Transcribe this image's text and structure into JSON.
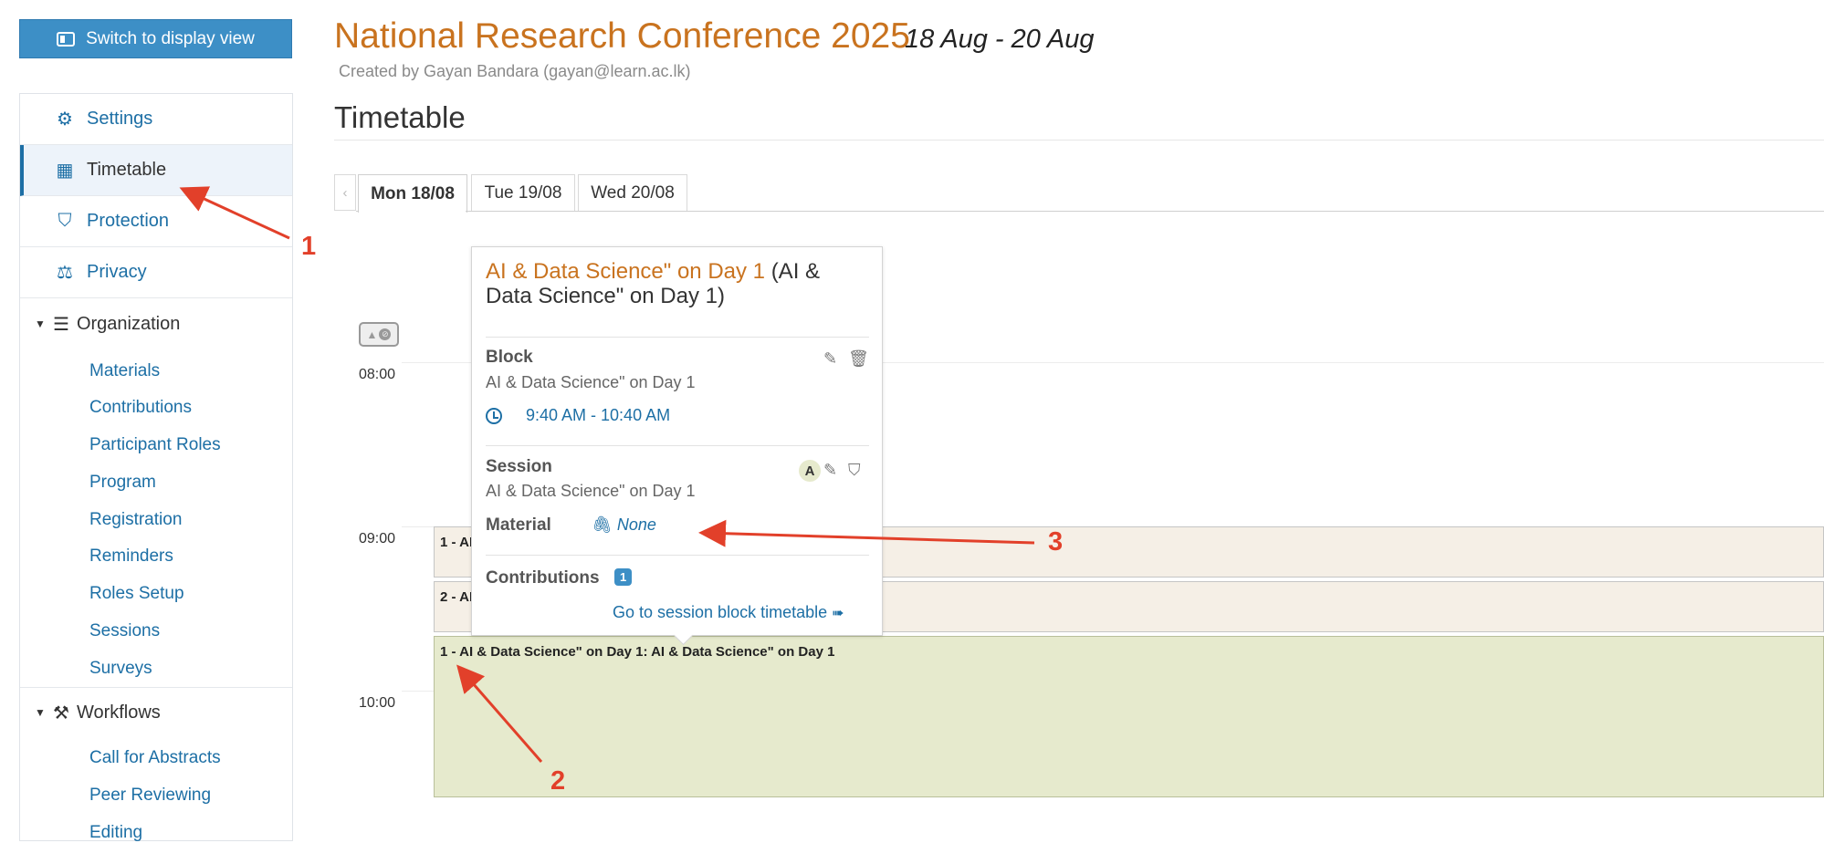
{
  "switch_view": {
    "label": "Switch to display view"
  },
  "sidebar": {
    "items": [
      {
        "label": "Settings",
        "icon": "gear-icon"
      },
      {
        "label": "Timetable",
        "icon": "calendar-icon",
        "active": true
      },
      {
        "label": "Protection",
        "icon": "shield-icon"
      },
      {
        "label": "Privacy",
        "icon": "scales-icon"
      }
    ],
    "organization": {
      "label": "Organization",
      "items": [
        "Materials",
        "Contributions",
        "Participant Roles",
        "Program",
        "Registration",
        "Reminders",
        "Roles Setup",
        "Sessions",
        "Surveys"
      ]
    },
    "workflows": {
      "label": "Workflows",
      "items": [
        "Call for Abstracts",
        "Peer Reviewing",
        "Editing"
      ]
    }
  },
  "event": {
    "title": "National Research Conference 2025",
    "dates": "18 Aug - 20 Aug",
    "created_by": "Created by Gayan Bandara (gayan@learn.ac.lk)"
  },
  "page_title": "Timetable",
  "tabs": [
    {
      "label": "Mon 18/08",
      "active": true
    },
    {
      "label": "Tue 19/08"
    },
    {
      "label": "Wed 20/08"
    }
  ],
  "timeline": {
    "times": [
      "08:00",
      "09:00",
      "10:00"
    ],
    "blocks": [
      {
        "label": "1 - AI & Data Science\" on Day 1: AI & Data Science\" on Day 1"
      },
      {
        "label": "2 - AI & Data Science\" on Day 1: AI & Data Science\" on Day 1"
      },
      {
        "label": "1 - AI & Data Science\" on Day 1: AI & Data Science\" on Day 1"
      }
    ]
  },
  "popover": {
    "title_main": "AI & Data Science\" on Day 1",
    "title_sub": "(AI & Data Science\" on Day 1)",
    "block_label": "Block",
    "block_value": "AI & Data Science\" on Day 1",
    "time_range": "9:40 AM - 10:40 AM",
    "session_label": "Session",
    "session_value": "AI & Data Science\" on Day 1",
    "session_badge": "A",
    "material_label": "Material",
    "material_value": "None",
    "contributions_label": "Contributions",
    "contributions_count": "1",
    "goto_link": "Go to session block timetable"
  },
  "annotations": [
    "1",
    "2",
    "3"
  ],
  "colors": {
    "accent": "#1d6fa5",
    "title": "#c9731f",
    "annotation": "#e2402a",
    "session_bg": "#e6eacd",
    "block_bg": "#f5efe6"
  }
}
